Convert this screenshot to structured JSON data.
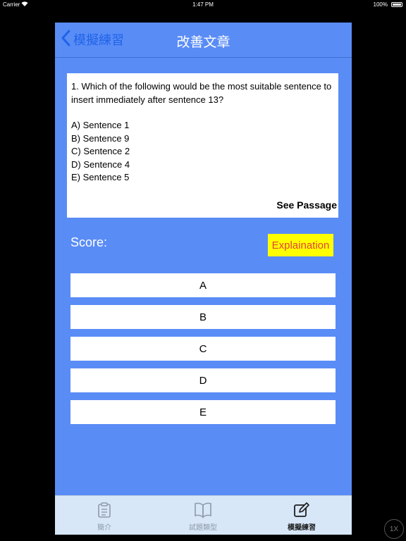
{
  "status_bar": {
    "carrier": "Carrier",
    "time": "1:47 PM",
    "battery": "100%"
  },
  "navbar": {
    "back_label": "模擬練習",
    "title": "改善文章"
  },
  "question": {
    "text": "1. Which of the following would be the most suitable sentence to insert immediately after sentence 13?",
    "options": [
      "A) Sentence 1",
      "B) Sentence 9",
      "C) Sentence 2",
      "D) Sentence 4",
      "E) Sentence 5"
    ],
    "see_passage": "See Passage"
  },
  "score_label": "Score:",
  "explain_label": "Explaination",
  "answers": [
    "A",
    "B",
    "C",
    "D",
    "E"
  ],
  "tabs": [
    {
      "label": "簡介",
      "icon": "clipboard-icon"
    },
    {
      "label": "試題類型",
      "icon": "book-icon"
    },
    {
      "label": "模擬練習",
      "icon": "edit-icon"
    }
  ],
  "zoom_badge": "1X",
  "colors": {
    "background": "#5a8cf6",
    "accent": "#1f64e8",
    "highlight": "#ffff00",
    "highlight_text": "#e0443c",
    "tabbar": "#d7e7f8"
  }
}
